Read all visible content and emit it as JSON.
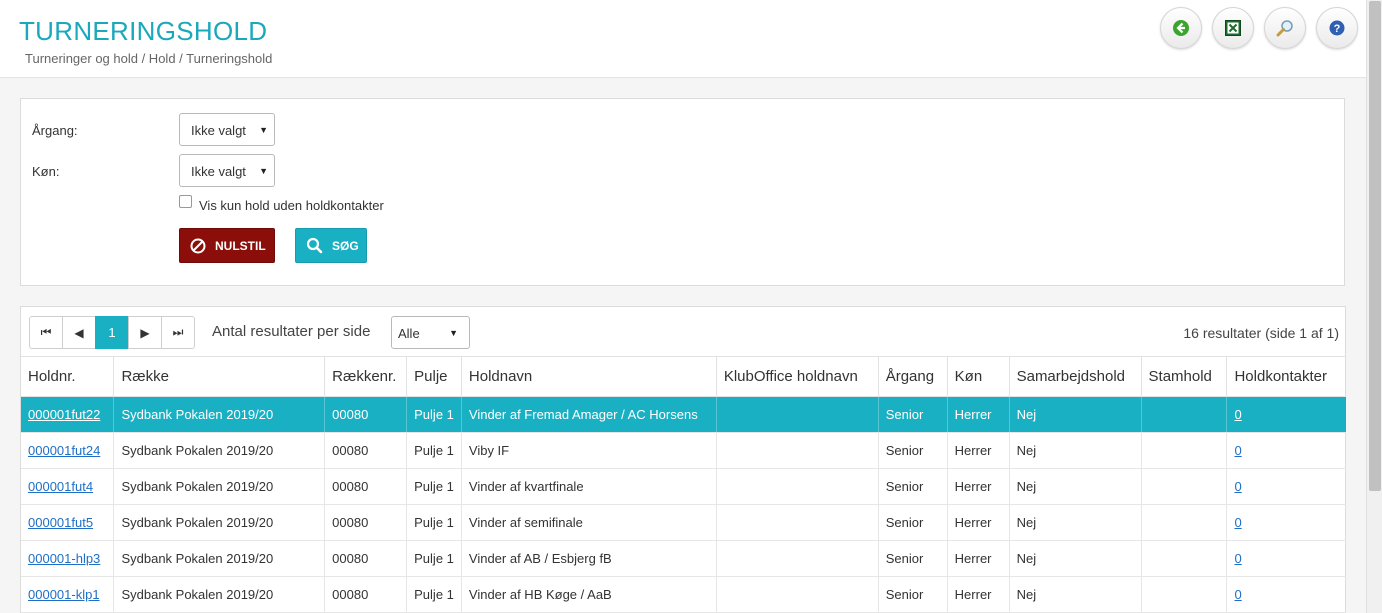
{
  "header": {
    "title": "TURNERINGSHOLD",
    "breadcrumb": "Turneringer og hold / Hold / Turneringshold",
    "tools": [
      {
        "name": "back",
        "icon": "back-arrow-icon"
      },
      {
        "name": "excel",
        "icon": "excel-icon"
      },
      {
        "name": "search",
        "icon": "magnifier-icon"
      },
      {
        "name": "help",
        "icon": "help-icon"
      }
    ]
  },
  "filters": {
    "year_label": "Årgang:",
    "year_value": "Ikke valgt",
    "gender_label": "Køn:",
    "gender_value": "Ikke valgt",
    "checkbox_label": "Vis kun hold uden holdkontakter",
    "reset_label": "NULSTIL",
    "search_label": "SØG"
  },
  "results": {
    "current_page": "1",
    "per_page_label": "Antal resultater per side",
    "per_page_value": "Alle",
    "count_text": "16 resultater (side 1 af 1)",
    "columns": [
      "Holdnr.",
      "Række",
      "Rækkenr.",
      "Pulje",
      "Holdnavn",
      "KlubOffice holdnavn",
      "Årgang",
      "Køn",
      "Samarbejdshold",
      "Stamhold",
      "Holdkontakter"
    ],
    "rows": [
      {
        "holdnr": "000001fut22",
        "raekke": "Sydbank Pokalen 2019/20",
        "raekkenr": "00080",
        "pulje": "Pulje 1",
        "holdnavn": "Vinder af Fremad Amager / AC Horsens",
        "klub": "",
        "aargang": "Senior",
        "koen": "Herrer",
        "samarbejd": "Nej",
        "stamhold": "",
        "kontakter": "0"
      },
      {
        "holdnr": "000001fut24",
        "raekke": "Sydbank Pokalen 2019/20",
        "raekkenr": "00080",
        "pulje": "Pulje 1",
        "holdnavn": "Viby IF",
        "klub": "",
        "aargang": "Senior",
        "koen": "Herrer",
        "samarbejd": "Nej",
        "stamhold": "",
        "kontakter": "0"
      },
      {
        "holdnr": "000001fut4",
        "raekke": "Sydbank Pokalen 2019/20",
        "raekkenr": "00080",
        "pulje": "Pulje 1",
        "holdnavn": "Vinder af kvartfinale",
        "klub": "",
        "aargang": "Senior",
        "koen": "Herrer",
        "samarbejd": "Nej",
        "stamhold": "",
        "kontakter": "0"
      },
      {
        "holdnr": "000001fut5",
        "raekke": "Sydbank Pokalen 2019/20",
        "raekkenr": "00080",
        "pulje": "Pulje 1",
        "holdnavn": "Vinder af semifinale",
        "klub": "",
        "aargang": "Senior",
        "koen": "Herrer",
        "samarbejd": "Nej",
        "stamhold": "",
        "kontakter": "0"
      },
      {
        "holdnr": "000001-hlp3",
        "raekke": "Sydbank Pokalen 2019/20",
        "raekkenr": "00080",
        "pulje": "Pulje 1",
        "holdnavn": "Vinder af AB / Esbjerg fB",
        "klub": "",
        "aargang": "Senior",
        "koen": "Herrer",
        "samarbejd": "Nej",
        "stamhold": "",
        "kontakter": "0"
      },
      {
        "holdnr": "000001-klp1",
        "raekke": "Sydbank Pokalen 2019/20",
        "raekkenr": "00080",
        "pulje": "Pulje 1",
        "holdnavn": "Vinder af HB Køge / AaB",
        "klub": "",
        "aargang": "Senior",
        "koen": "Herrer",
        "samarbejd": "Nej",
        "stamhold": "",
        "kontakter": "0"
      }
    ]
  },
  "colors": {
    "accent": "#1ab0c4",
    "title": "#1aa8bd",
    "reset": "#8b0e0a",
    "link": "#1f6fc7"
  }
}
